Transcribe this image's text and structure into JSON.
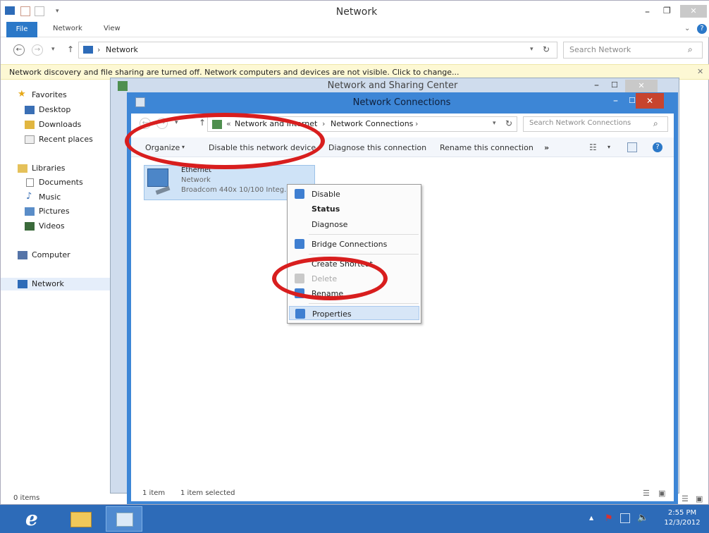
{
  "outer_window": {
    "title": "Network",
    "tabs": {
      "file": "File",
      "network": "Network",
      "view": "View"
    },
    "address": {
      "crumb": "Network",
      "search_placeholder": "Search Network"
    },
    "infobar": "Network discovery and file sharing are turned off. Network computers and devices are not visible. Click to change...",
    "status": "0 items"
  },
  "navigation": {
    "items": [
      {
        "label": "Favorites"
      },
      {
        "label": "Desktop"
      },
      {
        "label": "Downloads"
      },
      {
        "label": "Recent places"
      },
      {
        "label": "Libraries"
      },
      {
        "label": "Documents"
      },
      {
        "label": "Music"
      },
      {
        "label": "Pictures"
      },
      {
        "label": "Videos"
      },
      {
        "label": "Computer"
      },
      {
        "label": "Network"
      }
    ]
  },
  "sharing_center": {
    "title": "Network and Sharing Center"
  },
  "connections_window": {
    "title": "Network Connections",
    "address": {
      "crumb_parent": "Network and Internet",
      "crumb_current": "Network Connections",
      "search_placeholder": "Search Network Connections"
    },
    "commands": {
      "organize": "Organize",
      "disable": "Disable this network device",
      "diagnose": "Diagnose this connection",
      "rename": "Rename this connection",
      "more": "»"
    },
    "connection": {
      "name": "Ethernet",
      "status": "Network",
      "adapter": "Broadcom 440x 10/100 Integ..."
    },
    "status_bar": {
      "count": "1 item",
      "selected": "1 item selected"
    }
  },
  "context_menu": {
    "disable": "Disable",
    "status": "Status",
    "diagnose": "Diagnose",
    "bridge": "Bridge Connections",
    "shortcut": "Create Shortcut",
    "delete": "Delete",
    "rename": "Rename",
    "properties": "Properties"
  },
  "taskbar": {
    "time": "2:55 PM",
    "date": "12/3/2012"
  },
  "colors": {
    "accent": "#3d86d6",
    "annotation_ring": "#d81e1e",
    "infobar": "#fdf8d4",
    "taskbar": "#2d6bb8"
  }
}
